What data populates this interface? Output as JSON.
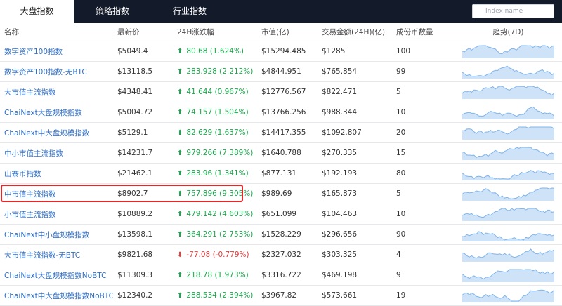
{
  "tabs": [
    {
      "label": "大盘指数",
      "active": true
    },
    {
      "label": "策略指数",
      "active": false
    },
    {
      "label": "行业指数",
      "active": false
    }
  ],
  "search": {
    "placeholder": "Index name"
  },
  "table": {
    "headers": [
      "名称",
      "最新价",
      "24H涨跌幅",
      "市值(亿)",
      "交易金额(24H)(亿)",
      "成份币数量",
      "趋势(7D)"
    ],
    "rows": [
      {
        "name": "数字资产100指数",
        "price": "$5049.4",
        "change": "80.68 (1.624%)",
        "direction": "up",
        "market_cap": "$15294.485",
        "volume": "$1285",
        "count": "100"
      },
      {
        "name": "数字资产100指数-无BTC",
        "price": "$13118.5",
        "change": "283.928 (2.212%)",
        "direction": "up",
        "market_cap": "$4844.951",
        "volume": "$765.854",
        "count": "99"
      },
      {
        "name": "大市值主流指数",
        "price": "$4348.41",
        "change": "41.644 (0.967%)",
        "direction": "up",
        "market_cap": "$12776.567",
        "volume": "$822.471",
        "count": "5"
      },
      {
        "name": "ChaiNext大盘规模指数",
        "price": "$5004.72",
        "change": "74.157 (1.504%)",
        "direction": "up",
        "market_cap": "$13766.256",
        "volume": "$988.344",
        "count": "10"
      },
      {
        "name": "ChaiNext中大盘规模指数",
        "price": "$5129.1",
        "change": "82.629 (1.637%)",
        "direction": "up",
        "market_cap": "$14417.355",
        "volume": "$1092.807",
        "count": "20"
      },
      {
        "name": "中小市值主流指数",
        "price": "$14231.7",
        "change": "979.266 (7.389%)",
        "direction": "up",
        "market_cap": "$1640.788",
        "volume": "$270.335",
        "count": "15"
      },
      {
        "name": "山寨币指数",
        "price": "$21462.1",
        "change": "283.96 (1.341%)",
        "direction": "up",
        "market_cap": "$877.131",
        "volume": "$192.193",
        "count": "80"
      },
      {
        "name": "中市值主流指数",
        "price": "$8902.7",
        "change": "757.896 (9.305%)",
        "direction": "up",
        "market_cap": "$989.69",
        "volume": "$165.873",
        "count": "5",
        "highlighted": true
      },
      {
        "name": "小市值主流指数",
        "price": "$10889.2",
        "change": "479.142 (4.603%)",
        "direction": "up",
        "market_cap": "$651.099",
        "volume": "$104.463",
        "count": "10"
      },
      {
        "name": "ChaiNext中小盘规模指数",
        "price": "$13598.1",
        "change": "364.291 (2.753%)",
        "direction": "up",
        "market_cap": "$1528.229",
        "volume": "$296.656",
        "count": "90"
      },
      {
        "name": "大市值主流指数-无BTC",
        "price": "$9821.68",
        "change": "-77.08 (-0.779%)",
        "direction": "down",
        "market_cap": "$2327.032",
        "volume": "$303.325",
        "count": "4"
      },
      {
        "name": "ChaiNext大盘规模指数NoBTC",
        "price": "$11309.3",
        "change": "218.78 (1.973%)",
        "direction": "up",
        "market_cap": "$3316.722",
        "volume": "$469.198",
        "count": "9"
      },
      {
        "name": "ChaiNext中大盘规模指数NoBTC",
        "price": "$12340.2",
        "change": "288.534 (2.394%)",
        "direction": "up",
        "market_cap": "$3967.82",
        "volume": "$573.661",
        "count": "19"
      }
    ]
  },
  "icons": {
    "up": "arrow-up-icon",
    "down": "arrow-down-icon"
  },
  "colors": {
    "topbar": "#131a2a",
    "link": "#2f6fc6",
    "up": "#1aa64b",
    "down": "#e23b3b",
    "sparkline": "#7fb4ea",
    "highlight_border": "#e02a2a"
  }
}
